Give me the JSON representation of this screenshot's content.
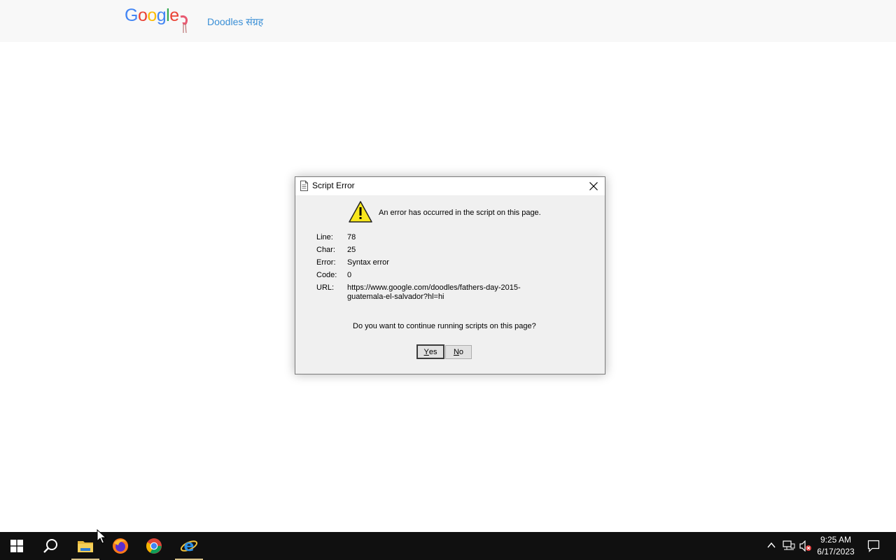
{
  "header": {
    "logo_text": "Google",
    "doodles_link": "Doodles संग्रह"
  },
  "dialog": {
    "title": "Script Error",
    "message": "An error has occurred in the script on this page.",
    "details": [
      {
        "key": "Line:",
        "value": "78"
      },
      {
        "key": "Char:",
        "value": "25"
      },
      {
        "key": "Error:",
        "value": "Syntax error"
      },
      {
        "key": "Code:",
        "value": "0"
      },
      {
        "key": "URL:",
        "value": "https://www.google.com/doodles/fathers-day-2015-guatemala-el-salvador?hl=hi"
      }
    ],
    "question": "Do you want to continue running scripts on this page?",
    "yes_label_accel": "Y",
    "yes_label_rest": "es",
    "no_label_accel": "N",
    "no_label_rest": "o"
  },
  "taskbar": {
    "apps": [
      "start-icon",
      "search-icon",
      "file-explorer-icon",
      "firefox-icon",
      "chrome-icon",
      "internet-explorer-icon"
    ],
    "time": "9:25 AM",
    "date": "6/17/2023"
  }
}
